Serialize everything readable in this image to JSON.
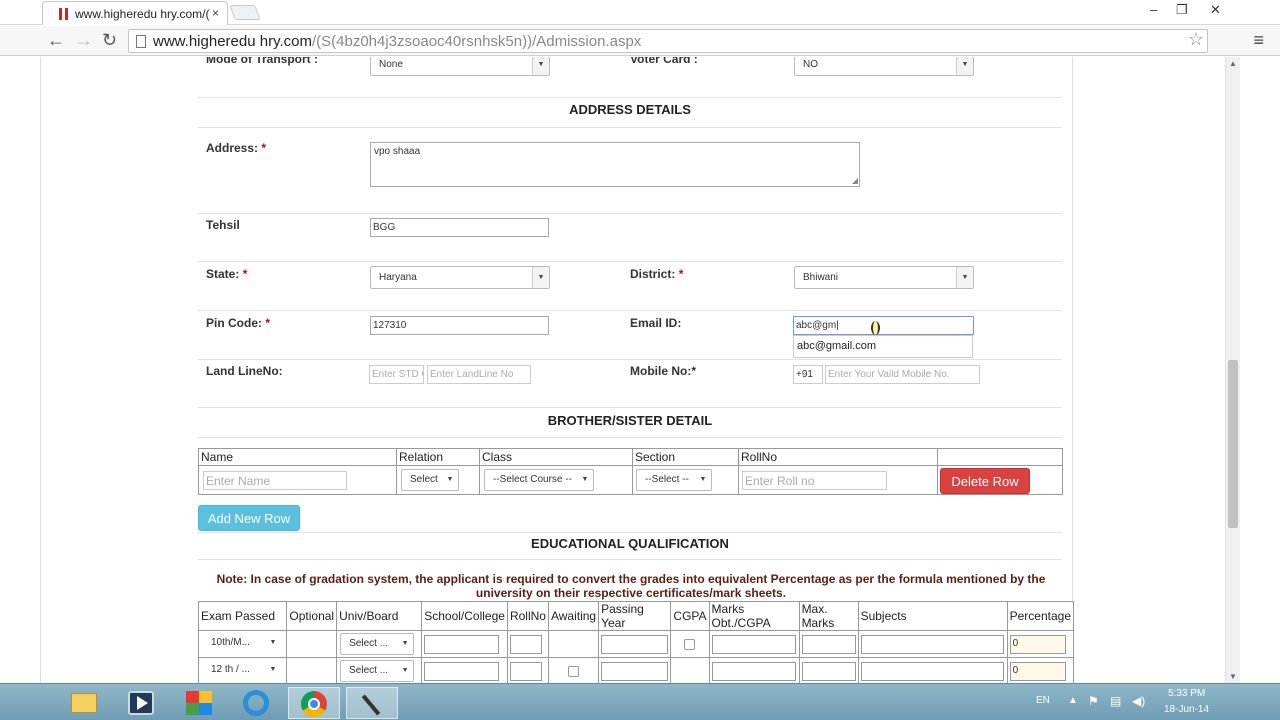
{
  "browser": {
    "tab_title": "www.higheredu hry.com/(",
    "tab_close": "×",
    "url_domain": "www.higheredu hry.com",
    "url_path": "/(S(4bz0h4j3zsoaoc40rsnhsk5n))/Admission.aspx",
    "window_controls": [
      "–",
      "❐",
      "✕"
    ]
  },
  "transport": {
    "label": "Mode of Transport :",
    "value": "None"
  },
  "voter": {
    "label": "Voter Card :",
    "value": "NO"
  },
  "address_section": {
    "title": "ADDRESS DETAILS"
  },
  "address": {
    "label": "Address:",
    "req": "*",
    "value": "vpo shaaa"
  },
  "tehsil": {
    "label": "Tehsil",
    "value": "BGG"
  },
  "state": {
    "label": "State:",
    "req": "*",
    "value": "Haryana"
  },
  "district": {
    "label": "District:",
    "req": "*",
    "value": "Bhiwani"
  },
  "pincode": {
    "label": "Pin Code:",
    "req": "*",
    "value": "127310"
  },
  "email": {
    "label": "Email ID:",
    "value": "abc@gm",
    "suggestion": "abc@gmail.com"
  },
  "landline": {
    "label": "Land LineNo:",
    "std_placeholder": "Enter STD C",
    "number_placeholder": "Enter LandLine No"
  },
  "mobile": {
    "label": "Mobile No:*",
    "prefix": "+91",
    "placeholder": "Enter Your Vaild Mobile No."
  },
  "sibling_section": {
    "title": "BROTHER/SISTER DETAIL",
    "headers": [
      "Name",
      "Relation",
      "Class",
      "Section",
      "RollNo"
    ],
    "name_placeholder": "Enter Name",
    "relation_value": "Select",
    "class_value": "--Select Course --",
    "section_value": "--Select --",
    "rollno_placeholder": "Enter Roll no",
    "delete_button": "Delete Row",
    "add_button": "Add New Row"
  },
  "education_section": {
    "title": "EDUCATIONAL QUALIFICATION",
    "note": "Note: In case of gradation system, the applicant is required to convert the grades into equivalent Percentage as per the formula mentioned by the university on their respective certificates/mark sheets.",
    "headers": [
      "Exam Passed",
      "Optional",
      "Univ/Board",
      "School/College",
      "RollNo",
      "Awaiting",
      "Passing Year",
      "CGPA",
      "Marks Obt./CGPA",
      "Max. Marks",
      "Subjects",
      "Percentage"
    ],
    "rows": [
      {
        "exam": "10th/M...",
        "univ": "Select ...",
        "percentage": "0"
      },
      {
        "exam": "12 th / ...",
        "univ": "Select ...",
        "percentage": "0"
      }
    ]
  },
  "taskbar": {
    "lang": "EN",
    "time": "5:33 PM",
    "date": "18-Jun-14"
  },
  "colors": {
    "required": "#cc0000",
    "delete": "#d9423f",
    "add": "#5bc0de",
    "note": "#5a1f12"
  }
}
